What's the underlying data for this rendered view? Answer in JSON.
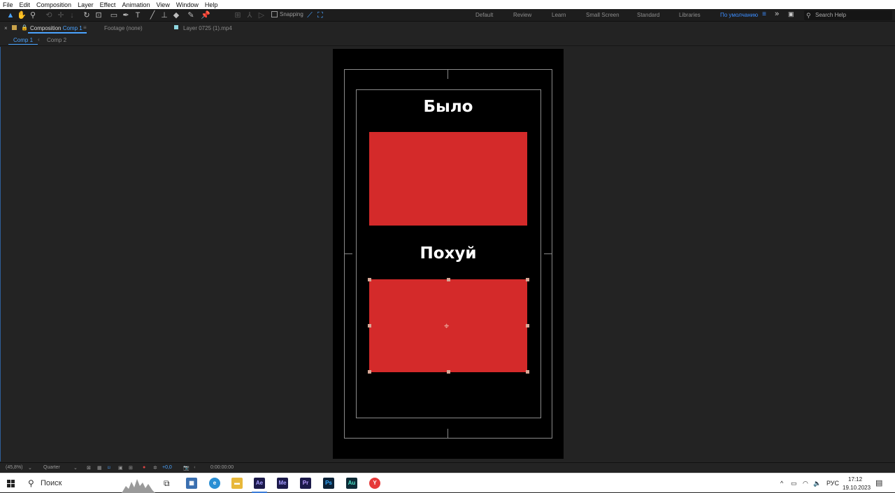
{
  "menu": [
    "File",
    "Edit",
    "Composition",
    "Layer",
    "Effect",
    "Animation",
    "View",
    "Window",
    "Help"
  ],
  "toolbar": {
    "snapping_label": "Snapping",
    "workspaces": [
      "Default",
      "Review",
      "Learn",
      "Small Screen",
      "Standard",
      "Libraries"
    ],
    "active_workspace": "По умолчанию",
    "search_placeholder": "Search Help"
  },
  "panels": {
    "composition_prefix": "Composition",
    "composition_name": "Comp 1",
    "footage_label": "Footage (none)",
    "layer_label": "Layer 0725 (1).mp4"
  },
  "comp_tabs": [
    "Comp 1",
    "Comp 2"
  ],
  "canvas": {
    "title_top": "Было",
    "title_bottom": "Похуй",
    "rect_color": "#d42a2a",
    "background": "#000000"
  },
  "viewer_footer": {
    "zoom": "(45,8%)",
    "resolution": "Quarter",
    "exposure": "+0,0",
    "timecode": "0:00:00:00"
  },
  "taskbar": {
    "search_label": "Поиск",
    "apps": [
      "Ae",
      "Me",
      "Pr",
      "Ps",
      "Au"
    ],
    "language": "РУС",
    "time": "17:12",
    "date": "19.10.2023"
  }
}
